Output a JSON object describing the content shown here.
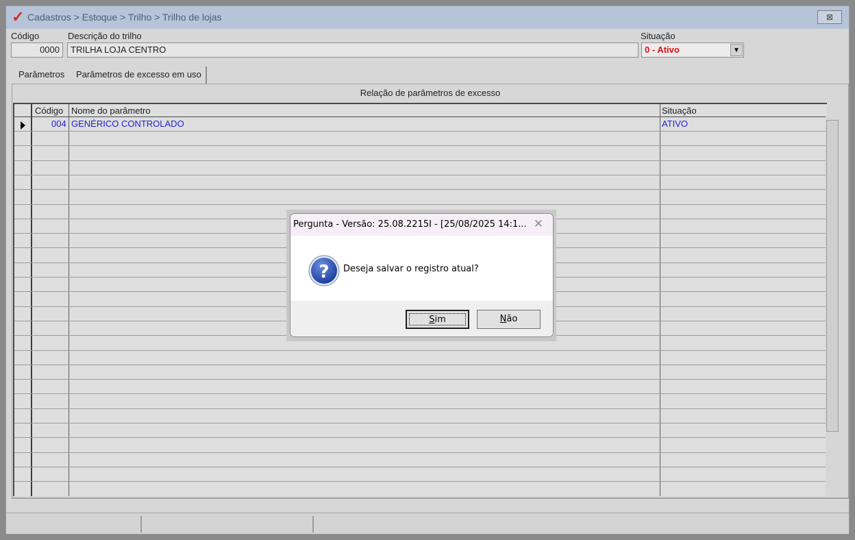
{
  "window": {
    "title": "Cadastros > Estoque > Trilho > Trilho de lojas",
    "close_symbol": "⊠"
  },
  "form": {
    "codigo_label": "Código",
    "codigo_value": "0000",
    "descricao_label": "Descrição do trilho",
    "descricao_value": "TRILHA LOJA CENTRO",
    "situacao_label": "Situação",
    "situacao_value": "0 - Ativo"
  },
  "tabs": [
    {
      "label": "Parâmetros"
    },
    {
      "label": "Parâmetros de excesso em uso"
    }
  ],
  "panel": {
    "heading": "Relação de parâmetros de excesso"
  },
  "grid": {
    "columns": [
      "Código",
      "Nome do parâmetro",
      "Situação"
    ],
    "rows": [
      {
        "codigo": "004",
        "nome": "GENÉRICO CONTROLADO",
        "situacao": "ATIVO"
      }
    ]
  },
  "dialog": {
    "title": "Pergunta - Versão: 25.08.2215I - [25/08/2025 14:1...",
    "message": "Deseja salvar o registro atual?",
    "yes_label": "im",
    "yes_mnemonic": "S",
    "no_label": "ão",
    "no_mnemonic": "N"
  },
  "colors": {
    "accent_red": "#e01010",
    "grid_text_blue": "#2020d8"
  }
}
